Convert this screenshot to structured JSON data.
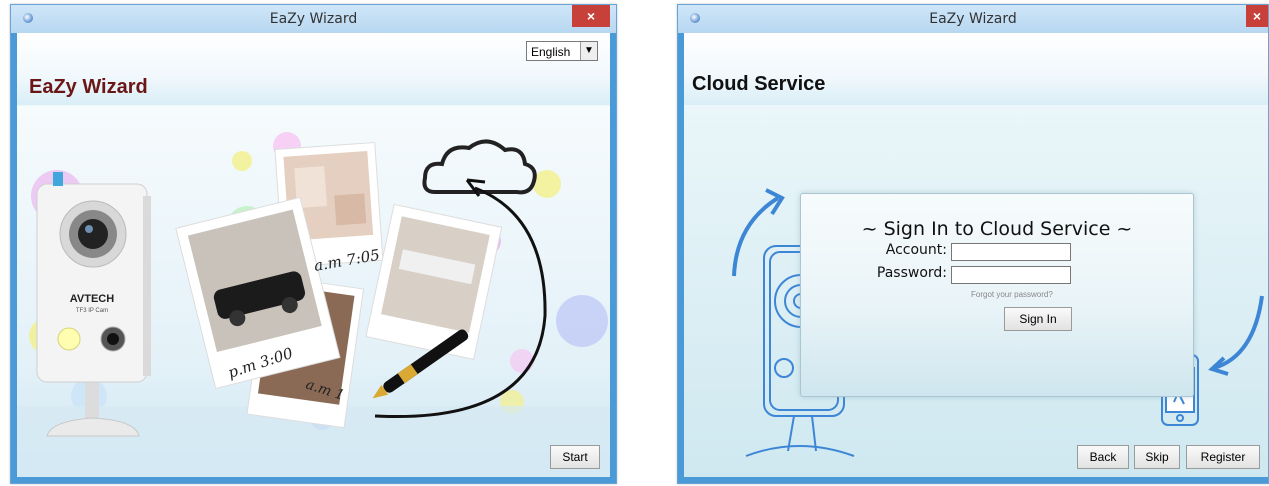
{
  "window1": {
    "title": "EaZy Wizard",
    "close_symbol": "×",
    "heading": "EaZy Wizard",
    "language": {
      "selected": "English",
      "arrow": "▼"
    },
    "illustration": {
      "camera_brand": "AVTECH",
      "camera_model": "TF3 IP Cam",
      "photo_labels": [
        "a.m 7:05",
        "p.m 3:00",
        "a.m 1"
      ]
    },
    "start_label": "Start"
  },
  "window2": {
    "title": "EaZy Wizard",
    "close_symbol": "×",
    "heading": "Cloud Service",
    "signin": {
      "title": "~ Sign In to Cloud Service ~",
      "account_label": "Account:",
      "password_label": "Password:",
      "account_value": "",
      "password_value": "",
      "forgot_text": "Forgot your password?",
      "signin_label": "Sign In"
    },
    "buttons": {
      "back": "Back",
      "skip": "Skip",
      "register": "Register"
    }
  },
  "colors": {
    "title_bar": "#b7d7f1",
    "close_red": "#c7413a",
    "heading_dark_red": "#6b1616",
    "sketch_blue": "#3d86d6"
  }
}
